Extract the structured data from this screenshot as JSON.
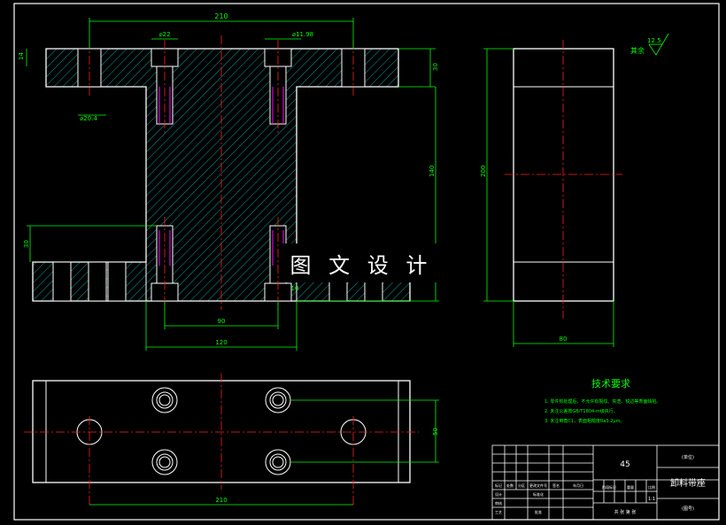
{
  "front_view": {
    "dim_total_width": "210",
    "dim_counterbore_dia": "⌀22",
    "dim_hole_dia": "⌀11.98",
    "dim_hole_dia2": "⌀20.4",
    "dim_flange_thk": "14",
    "dim_top_height": "30",
    "dim_body_height": "140",
    "dim_bottom_height": "30",
    "dim_hole_spacing": "90",
    "dim_base_width": "120",
    "dim_small": "10"
  },
  "side_view": {
    "dim_height": "200",
    "dim_width": "80",
    "roughness_label": "其余",
    "roughness_value": "12.5"
  },
  "top_view": {
    "dim_width": "210",
    "dim_depth": "50"
  },
  "notes": {
    "title": "技术要求",
    "items": [
      "1. 零件热处理后，不允许有裂纹、夹渣、锐边等表面缺陷。",
      "2. 未注公差按GB/T1804-m级执行。",
      "3. 未注倒角C1，表面粗糙度Ra3.2μm。"
    ]
  },
  "title_block": {
    "material": "45",
    "part_name": "卸料带座",
    "scale": "1:1",
    "label_unit": "(单位)",
    "label_drawing_no": "(图号)",
    "row_labels": [
      "标记",
      "处数",
      "分区",
      "更改文件号",
      "签名",
      "年月日"
    ],
    "row_labels2": [
      "设计",
      "",
      "标准化",
      "",
      "",
      "阶段标记",
      "重量",
      "比例"
    ],
    "row_labels3": [
      "审核",
      "",
      "",
      "",
      "",
      ""
    ],
    "row_labels4": [
      "工艺",
      "",
      "批准",
      "",
      "共  张  第  张"
    ]
  },
  "watermark": "图 文 设 计",
  "colors": {
    "outline": "#ffffff",
    "hatch": "#00c8c8",
    "dimension": "#00ff00",
    "centerline": "#ff2020",
    "thread": "#ff00ff",
    "border": "#ffffff"
  }
}
